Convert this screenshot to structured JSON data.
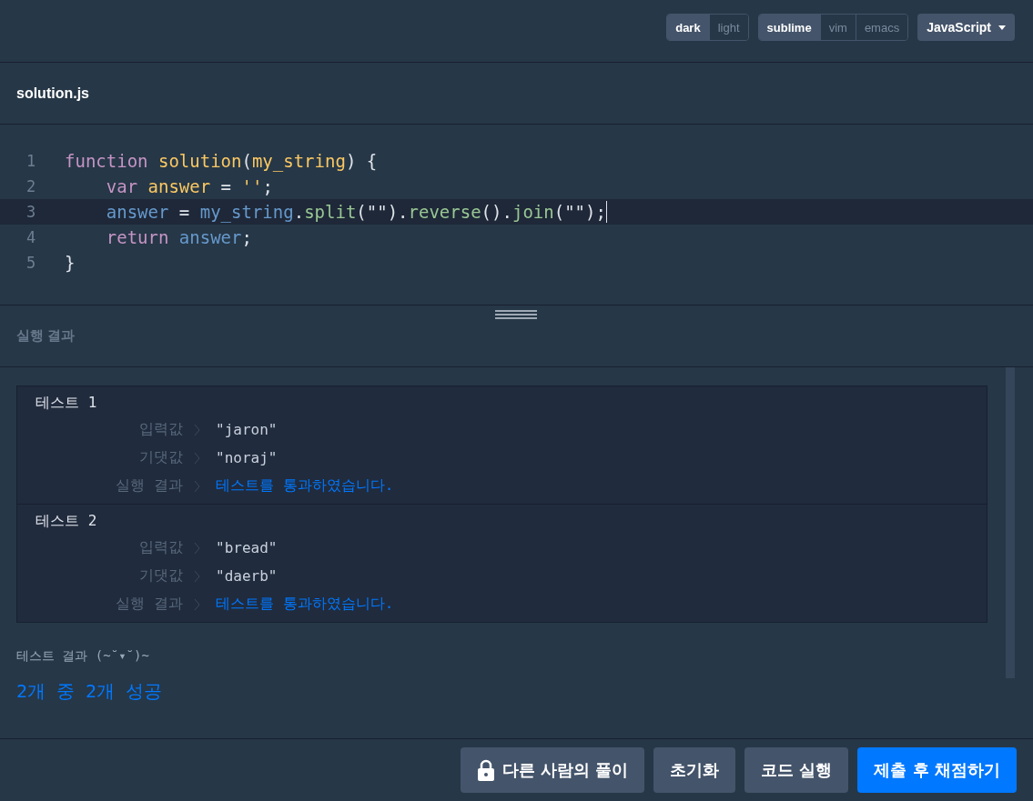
{
  "toolbar": {
    "toggle_groups": [
      {
        "options": [
          {
            "label": "dark",
            "selected": true
          },
          {
            "label": "light",
            "selected": false
          }
        ]
      },
      {
        "options": [
          {
            "label": "sublime",
            "selected": true
          },
          {
            "label": "vim",
            "selected": false
          },
          {
            "label": "emacs",
            "selected": false
          }
        ]
      }
    ],
    "language": {
      "label": "JavaScript"
    }
  },
  "file_tab": {
    "title": "solution.js"
  },
  "editor": {
    "lines": [
      {
        "number": "1",
        "active": false,
        "tokens": [
          {
            "kind": "keyword",
            "text": "function "
          },
          {
            "kind": "def",
            "text": "solution"
          },
          {
            "kind": "plain",
            "text": "("
          },
          {
            "kind": "def",
            "text": "my_string"
          },
          {
            "kind": "plain",
            "text": ") {"
          }
        ]
      },
      {
        "number": "2",
        "active": false,
        "tokens": [
          {
            "kind": "keyword",
            "text": "    var "
          },
          {
            "kind": "def",
            "text": "answer"
          },
          {
            "kind": "plain",
            "text": " = "
          },
          {
            "kind": "string",
            "text": "''"
          },
          {
            "kind": "plain",
            "text": ";"
          }
        ]
      },
      {
        "number": "3",
        "active": true,
        "tokens": [
          {
            "kind": "variable",
            "text": "    answer"
          },
          {
            "kind": "plain",
            "text": " = "
          },
          {
            "kind": "variable",
            "text": "my_string"
          },
          {
            "kind": "plain",
            "text": "."
          },
          {
            "kind": "property",
            "text": "split"
          },
          {
            "kind": "plain",
            "text": "(\"\")."
          },
          {
            "kind": "property",
            "text": "reverse"
          },
          {
            "kind": "plain",
            "text": "()."
          },
          {
            "kind": "property",
            "text": "join"
          },
          {
            "kind": "plain",
            "text": "(\"\");"
          }
        ]
      },
      {
        "number": "4",
        "active": false,
        "tokens": [
          {
            "kind": "keyword",
            "text": "    return "
          },
          {
            "kind": "variable",
            "text": "answer"
          },
          {
            "kind": "plain",
            "text": ";"
          }
        ]
      },
      {
        "number": "5",
        "active": false,
        "tokens": [
          {
            "kind": "plain",
            "text": "}"
          }
        ]
      }
    ]
  },
  "results": {
    "title": "실행 결과",
    "tests": [
      {
        "title": "테스트 1",
        "rows": [
          {
            "label": "입력값",
            "value": "\"jaron\"",
            "passed": false
          },
          {
            "label": "기댓값",
            "value": "\"noraj\"",
            "passed": false
          },
          {
            "label": "실행 결과",
            "value": "테스트를 통과하였습니다.",
            "passed": true
          }
        ]
      },
      {
        "title": "테스트 2",
        "rows": [
          {
            "label": "입력값",
            "value": "\"bread\"",
            "passed": false
          },
          {
            "label": "기댓값",
            "value": "\"daerb\"",
            "passed": false
          },
          {
            "label": "실행 결과",
            "value": "테스트를 통과하였습니다.",
            "passed": true
          }
        ]
      }
    ],
    "summary_label": "테스트 결과 (~˘▾˘)~",
    "summary": "2개 중 2개 성공"
  },
  "buttons": [
    {
      "label": "다른 사람의 풀이",
      "kind": "locked"
    },
    {
      "label": "초기화",
      "kind": "secondary"
    },
    {
      "label": "코드 실행",
      "kind": "secondary"
    },
    {
      "label": "제출 후 채점하기",
      "kind": "primary"
    }
  ]
}
